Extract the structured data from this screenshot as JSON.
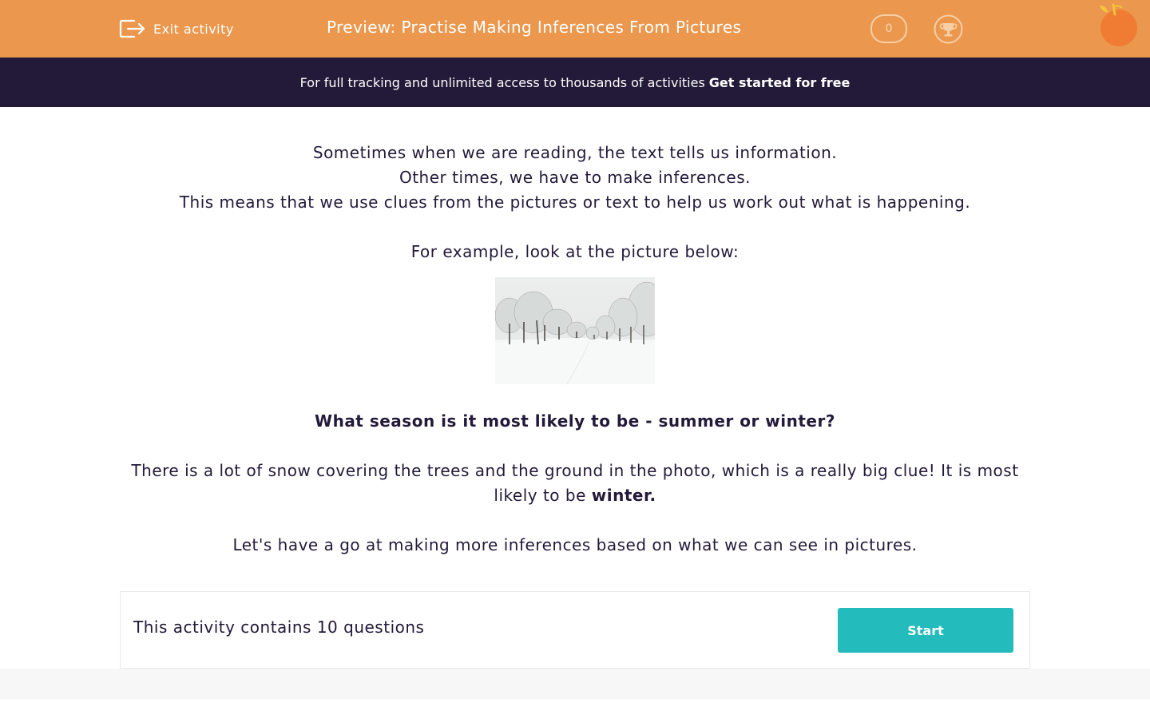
{
  "header": {
    "exit_label": "Exit activity",
    "title": "Preview: Practise Making Inferences From Pictures",
    "score": "0",
    "accent_color": "#eb984e"
  },
  "promo": {
    "text": "For full tracking and unlimited access to thousands of activities",
    "cta": "Get started for free",
    "background_color": "#231a39"
  },
  "content": {
    "intro_lines": [
      "Sometimes when we are reading, the text tells us information.",
      "Other times, we have to make inferences.",
      "This means that we use clues from the pictures or text to help us work out what is happening."
    ],
    "example_prompt": "For example, look at the picture below:",
    "question": "What season is it most likely to be - summer or winter?",
    "answer_text": "There is a lot of snow covering the trees and the ground in the photo, which is a really big clue! It is most likely to be",
    "answer_bold": "winter.",
    "closing": "Let's have a go at making more inferences based on what we can see in pictures."
  },
  "footer": {
    "info": "This activity contains 10 questions",
    "start_label": "Start",
    "button_color": "#23bbbb"
  },
  "icons": {
    "exit": "exit-icon",
    "trophy": "trophy-icon",
    "logo": "orange-logo"
  }
}
